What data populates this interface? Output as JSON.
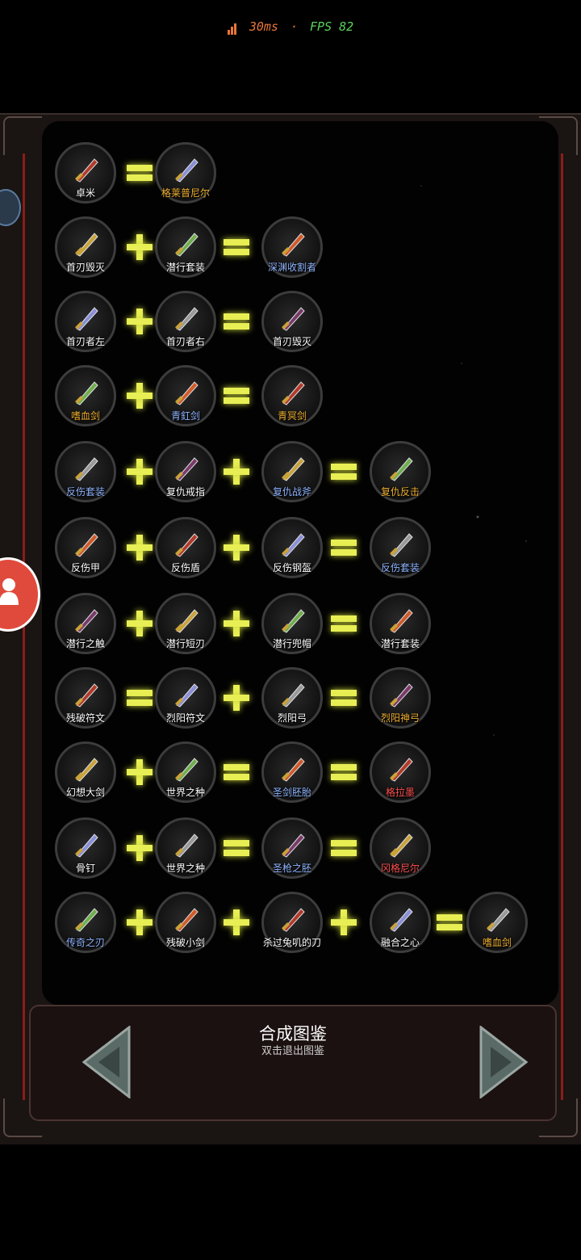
{
  "status": {
    "ping": "30ms",
    "separator": "·",
    "fps": "FPS 82"
  },
  "footer": {
    "title": "合成图鉴",
    "subtitle": "双击退出图鉴"
  },
  "recipes": [
    [
      "卓米",
      "=",
      "格莱普尼尔"
    ],
    [
      "首刃毁灭",
      "+",
      "潜行套装",
      "=",
      "深渊收割者"
    ],
    [
      "首刃者左",
      "+",
      "首刃者右",
      "=",
      "首刃毁灭"
    ],
    [
      "嗜血剑",
      "+",
      "青釭剑",
      "=",
      "青冥剑"
    ],
    [
      "反伤套装",
      "+",
      "复仇戒指",
      "+",
      "复仇战斧",
      "=",
      "复仇反击"
    ],
    [
      "反伤甲",
      "+",
      "反伤盾",
      "+",
      "反伤钢盔",
      "=",
      "反伤套装"
    ],
    [
      "潜行之触",
      "+",
      "潜行短刃",
      "+",
      "潜行兜帽",
      "=",
      "潜行套装"
    ],
    [
      "残破符文",
      "=",
      "烈阳符文",
      "+",
      "烈阳弓",
      "=",
      "烈阳神弓"
    ],
    [
      "幻想大剑",
      "+",
      "世界之种",
      "=",
      "圣剑胚胎",
      "=",
      "格拉墨"
    ],
    [
      "骨钉",
      "+",
      "世界之种",
      "=",
      "圣枪之胚",
      "=",
      "冈格尼尔"
    ],
    [
      "传奇之刃",
      "+",
      "残破小剑",
      "+",
      "杀过兔叽的刀",
      "+",
      "融合之心",
      "=",
      "嗜血剑"
    ]
  ],
  "colors": {
    "gold": "#f0b030",
    "blue": "#8fb4ff",
    "red": "#ff5050",
    "operator": "#e8ef54"
  }
}
